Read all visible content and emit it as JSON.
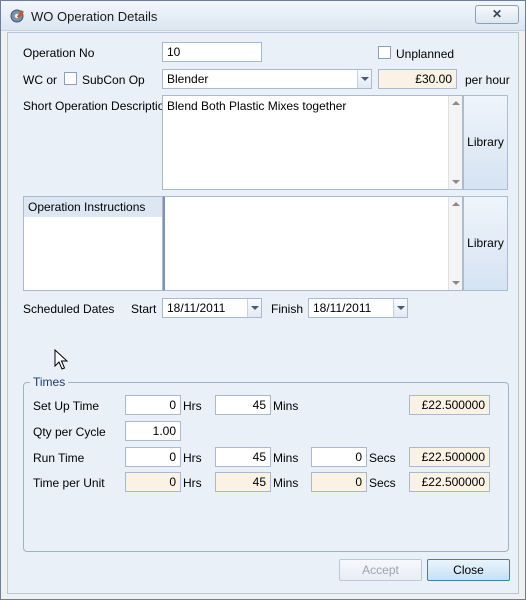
{
  "window": {
    "title": "WO Operation Details",
    "close_glyph": "✕"
  },
  "operation": {
    "op_no_label": "Operation No",
    "op_no_value": "10",
    "unplanned_label": "Unplanned",
    "wc_label": "WC or",
    "subcon_label": "SubCon Op",
    "workcentre_value": "Blender",
    "rate_value": "£30.00",
    "per_hour_label": "per hour",
    "short_desc_label": "Short Operation Description",
    "short_desc_value": "Blend Both Plastic Mixes together",
    "library_label": "Library",
    "instructions_label": "Operation Instructions",
    "instructions_value": "",
    "library2_label": "Library"
  },
  "schedule": {
    "label": "Scheduled Dates",
    "start_label": "Start",
    "start_value": "18/11/2011",
    "finish_label": "Finish",
    "finish_value": "18/11/2011"
  },
  "times": {
    "legend": "Times",
    "setup": {
      "label": "Set Up Time",
      "hrs": "0",
      "hrs_unit": "Hrs",
      "mins": "45",
      "mins_unit": "Mins",
      "cost": "£22.500000"
    },
    "qty": {
      "label": "Qty per Cycle",
      "value": "1.00"
    },
    "run": {
      "label": "Run Time",
      "hrs": "0",
      "hrs_unit": "Hrs",
      "mins": "45",
      "mins_unit": "Mins",
      "secs": "0",
      "secs_unit": "Secs",
      "cost": "£22.500000"
    },
    "per_unit": {
      "label": "Time per Unit",
      "hrs": "0",
      "hrs_unit": "Hrs",
      "mins": "45",
      "mins_unit": "Mins",
      "secs": "0",
      "secs_unit": "Secs",
      "cost": "£22.500000"
    }
  },
  "buttons": {
    "accept": "Accept",
    "close": "Close"
  }
}
